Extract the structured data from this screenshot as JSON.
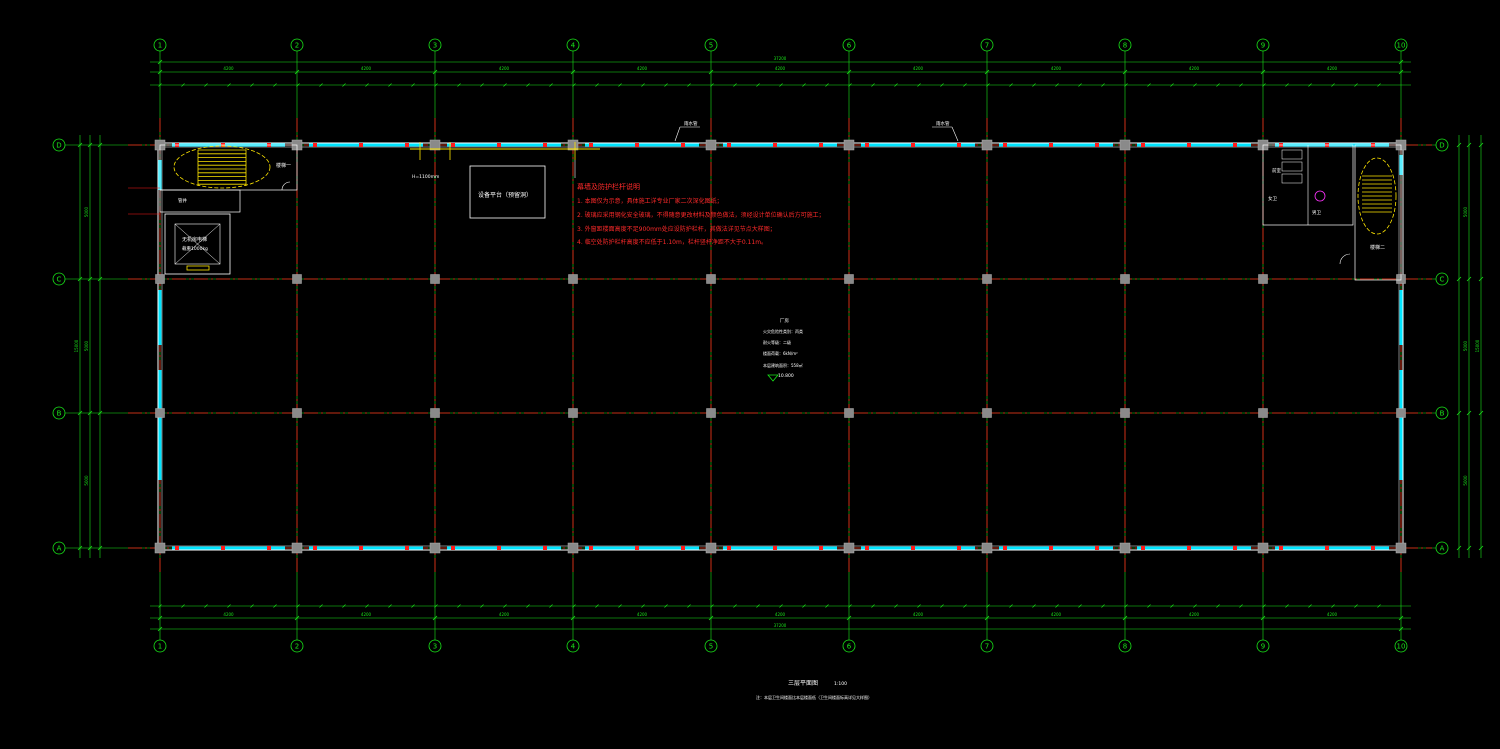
{
  "drawing": {
    "title": "三层平面图",
    "scale": "1:100",
    "footnote": "注：本层卫生间楼面比本层楼面低（卫生间楼面标高详见大样图）"
  },
  "colors": {
    "background": "#000000",
    "grid": "#ff1a1a",
    "dimension": "#19e619",
    "wall": "#ffffff",
    "window": "#00e5ff",
    "column": "#8a8a8a",
    "note": "#ff2a2a",
    "stair": "#ffe600",
    "bubble": "#19e619"
  },
  "axes": {
    "columns": [
      "1",
      "2",
      "3",
      "4",
      "5",
      "6",
      "7",
      "8",
      "9",
      "10"
    ],
    "rows": [
      "D",
      "C",
      "B",
      "A"
    ]
  },
  "dims": {
    "total_length": "37200",
    "bays": [
      "4200",
      "4200",
      "4200",
      "4200",
      "4200",
      "4200",
      "4200",
      "4200",
      "4200"
    ],
    "left_vertical": [
      "5000",
      "5000",
      "5000"
    ],
    "left_total": "15000",
    "right_vertical": [
      "5000",
      "5000",
      "5000"
    ],
    "right_total": "15000"
  },
  "notes": {
    "heading": "幕墙及防护栏杆说明",
    "items": [
      "1. 本图仅为示意，具体施工详专业厂家二次深化图纸；",
      "2. 玻璃应采用钢化安全玻璃，不得随意更改材料及颜色做法，须经设计单位确认后方可施工；",
      "3. 外窗距楼面高度不足900mm处应设防护栏杆，其做法详见节点大样图；",
      "4. 临空处防护栏杆高度不应低于1.10m，栏杆竖杆净距不大于0.11m。"
    ]
  },
  "labels": {
    "equipment": "设备平台（预留洞）",
    "freight_lift": "货梯",
    "platform_note": "H=1100mm",
    "lift_label": "无机房电梯",
    "lift_sub": "载重1000kg",
    "stair_left": "楼梯一",
    "stair_right": "楼梯二",
    "front_room": "前室",
    "toilet_w": "女卫",
    "toilet_m": "男卫",
    "workshop": "厂房",
    "workshop_lines": [
      "火灾危险性类别：丙类",
      "耐火等级：二级",
      "楼面荷载：6kN/m²",
      "本层建筑面积：558㎡"
    ],
    "elevation": "10.800",
    "pipe_shaft": "管井",
    "drain": "雨水管",
    "rwp": "排水沟"
  }
}
